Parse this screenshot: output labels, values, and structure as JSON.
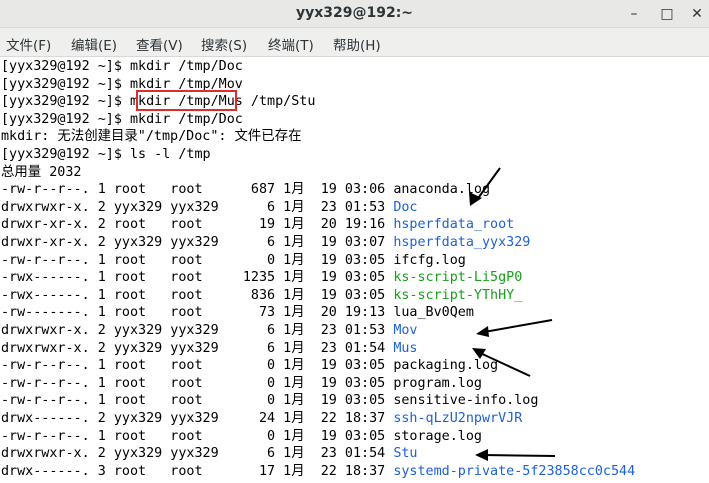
{
  "window": {
    "title": "yyx329@192:~",
    "minimize_glyph": "–",
    "maximize_glyph": "□",
    "close_glyph": "✕"
  },
  "menu": [
    "文件(F)",
    "编辑(E)",
    "查看(V)",
    "搜索(S)",
    "终端(T)",
    "帮助(H)"
  ],
  "terminal": {
    "lines": [
      {
        "text": "[yyx329@192 ~]$ mkdir /tmp/Doc"
      },
      {
        "text": "[yyx329@192 ~]$ mkdir /tmp/Mov"
      },
      {
        "text": "[yyx329@192 ~]$ mkdir /tmp/Mus /tmp/Stu"
      },
      {
        "text": "[yyx329@192 ~]$ mkdir /tmp/Doc"
      },
      {
        "text": "mkdir: 无法创建目录\"/tmp/Doc\": 文件已存在"
      },
      {
        "text": "[yyx329@192 ~]$ ls -l /tmp"
      },
      {
        "text": "总用量 2032"
      },
      {
        "text": "-rw-r--r--. 1 root   root      687 1月  19 03:06 ",
        "name": "anaconda.log",
        "color": ""
      },
      {
        "text": "drwxrwxr-x. 2 yyx329 yyx329      6 1月  23 01:53 ",
        "name": "Doc",
        "color": "blue"
      },
      {
        "text": "drwxr-xr-x. 2 root   root       19 1月  20 19:16 ",
        "name": "hsperfdata_root",
        "color": "blue"
      },
      {
        "text": "drwxr-xr-x. 2 yyx329 yyx329      6 1月  19 03:07 ",
        "name": "hsperfdata_yyx329",
        "color": "blue"
      },
      {
        "text": "-rw-r--r--. 1 root   root        0 1月  19 03:05 ",
        "name": "ifcfg.log",
        "color": ""
      },
      {
        "text": "-rwx------. 1 root   root     1235 1月  19 03:05 ",
        "name": "ks-script-Li5gP0",
        "color": "green"
      },
      {
        "text": "-rwx------. 1 root   root      836 1月  19 03:05 ",
        "name": "ks-script-YThHY_",
        "color": "green"
      },
      {
        "text": "-rw-------. 1 root   root       73 1月  20 19:13 ",
        "name": "lua_Bv0Qem",
        "color": ""
      },
      {
        "text": "drwxrwxr-x. 2 yyx329 yyx329      6 1月  23 01:53 ",
        "name": "Mov",
        "color": "blue"
      },
      {
        "text": "drwxrwxr-x. 2 yyx329 yyx329      6 1月  23 01:54 ",
        "name": "Mus",
        "color": "blue"
      },
      {
        "text": "-rw-r--r--. 1 root   root        0 1月  19 03:05 ",
        "name": "packaging.log",
        "color": ""
      },
      {
        "text": "-rw-r--r--. 1 root   root        0 1月  19 03:05 ",
        "name": "program.log",
        "color": ""
      },
      {
        "text": "-rw-r--r--. 1 root   root        0 1月  19 03:05 ",
        "name": "sensitive-info.log",
        "color": ""
      },
      {
        "text": "drwx------. 2 yyx329 yyx329     24 1月  22 18:37 ",
        "name": "ssh-qLzU2npwrVJR",
        "color": "blue"
      },
      {
        "text": "-rw-r--r--. 1 root   root        0 1月  19 03:05 ",
        "name": "storage.log",
        "color": ""
      },
      {
        "text": "drwxrwxr-x. 2 yyx329 yyx329      6 1月  23 01:54 ",
        "name": "Stu",
        "color": "blue"
      },
      {
        "text": "drwx------. 3 root   root       17 1月  22 18:37 ",
        "name": "systemd-private-5f23858cc0c544",
        "color": "blue"
      }
    ]
  },
  "annotations": {
    "highlight_color": "#e02b2b",
    "arrow_color": "#000000"
  }
}
